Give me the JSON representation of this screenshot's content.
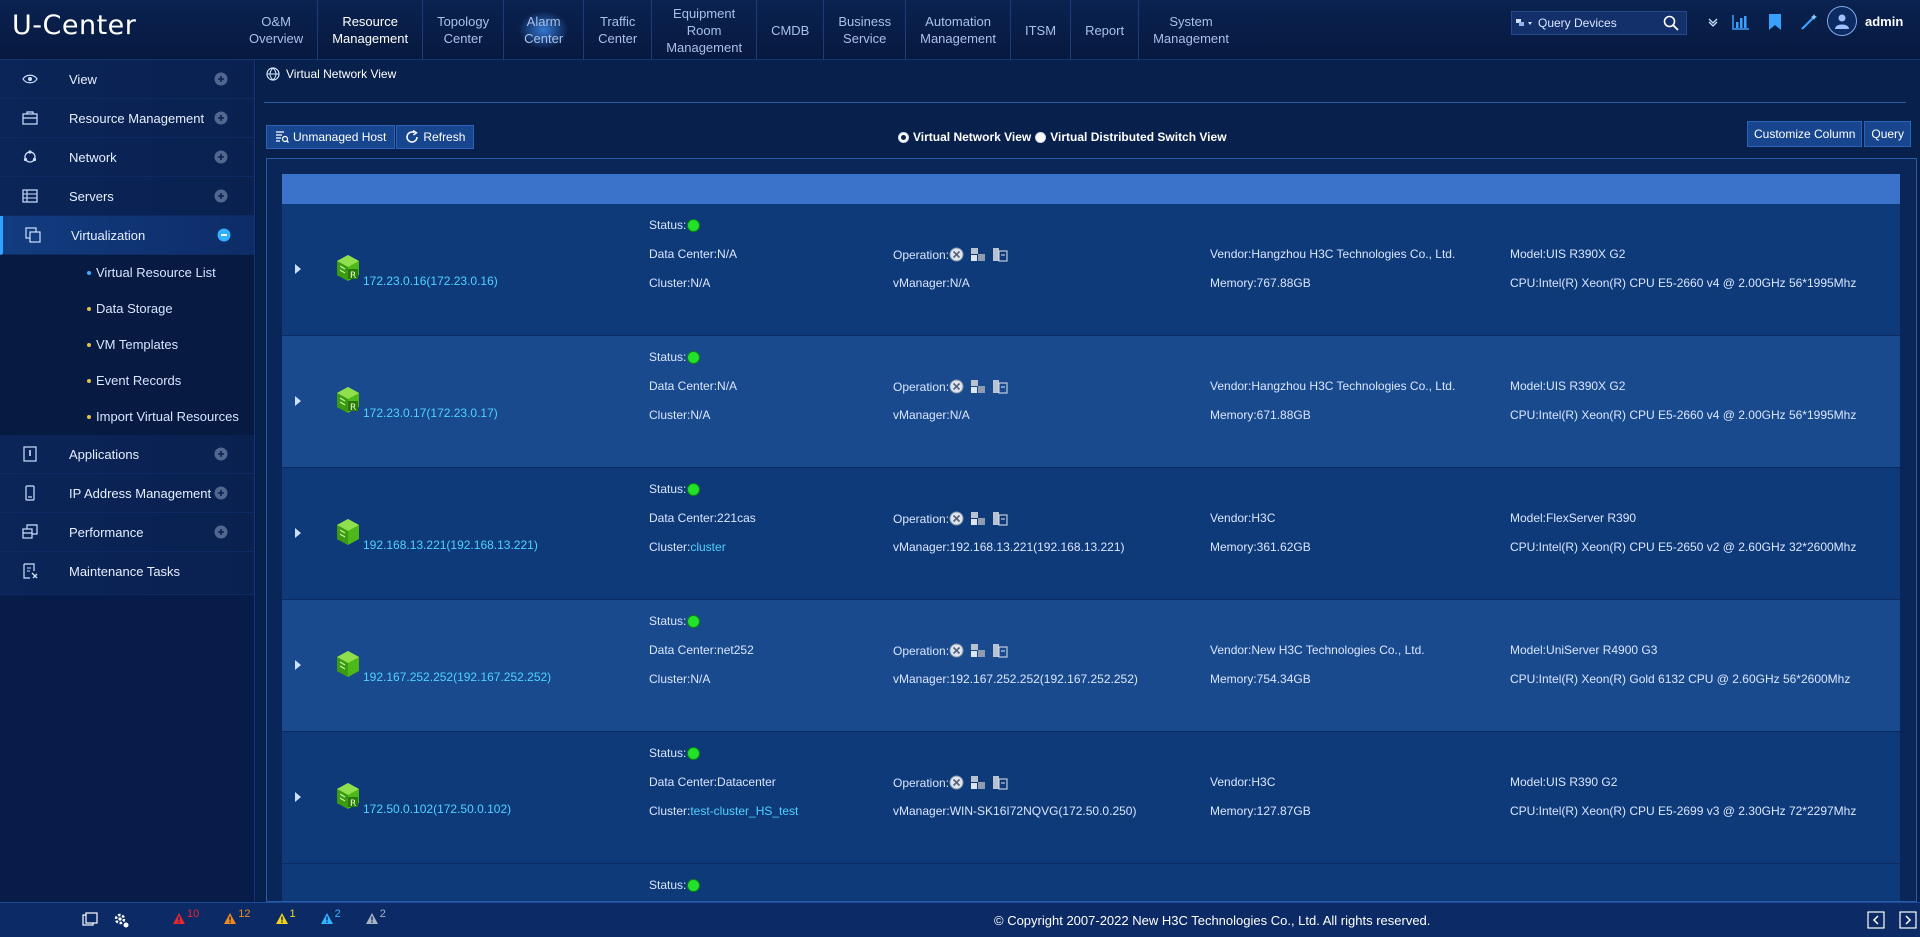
{
  "header": {
    "logo": "U-Center",
    "nav": [
      {
        "label": "O&M\nOverview"
      },
      {
        "label": "Resource\nManagement",
        "active": true
      },
      {
        "label": "Topology\nCenter"
      },
      {
        "label": "Alarm\nCenter",
        "glow": true
      },
      {
        "label": "Traffic\nCenter"
      },
      {
        "label": "Equipment\nRoom\nManagement"
      },
      {
        "label": "CMDB"
      },
      {
        "label": "Business\nService"
      },
      {
        "label": "Automation\nManagement"
      },
      {
        "label": "ITSM"
      },
      {
        "label": "Report"
      },
      {
        "label": "System\nManagement"
      }
    ],
    "search_placeholder": "Query Devices",
    "username": "admin"
  },
  "sidebar": {
    "items": [
      {
        "label": "View",
        "icon": "eye-icon"
      },
      {
        "label": "Resource Management",
        "icon": "briefcase-icon"
      },
      {
        "label": "Network",
        "icon": "network-icon"
      },
      {
        "label": "Servers",
        "icon": "server-icon"
      },
      {
        "label": "Virtualization",
        "icon": "virtualization-icon",
        "active": true
      }
    ],
    "sub_items": [
      {
        "label": "Virtual Resource List",
        "dot": "#4aa8ff"
      },
      {
        "label": "Data Storage",
        "dot": "#e3c04a"
      },
      {
        "label": "VM Templates",
        "dot": "#e3c04a"
      },
      {
        "label": "Event Records",
        "dot": "#e3c04a"
      },
      {
        "label": "Import Virtual Resources",
        "dot": "#e3c04a"
      }
    ],
    "items_after": [
      {
        "label": "Applications",
        "icon": "application-icon"
      },
      {
        "label": "IP Address Management",
        "icon": "ip-icon"
      },
      {
        "label": "Performance",
        "icon": "performance-icon"
      },
      {
        "label": "Maintenance Tasks",
        "icon": "maintenance-icon"
      }
    ]
  },
  "page": {
    "title": "Virtual Network View",
    "unmanaged_label": "Unmanaged Host",
    "refresh_label": "Refresh",
    "radio_vnv": "Virtual Network View",
    "radio_vds": "Virtual Distributed Switch View",
    "customize_label": "Customize Column",
    "query_label": "Query"
  },
  "labels": {
    "status": "Status:",
    "data_center": "Data Center:",
    "cluster": "Cluster:",
    "operation": "Operation:",
    "vmanager": "vManager:",
    "vendor": "Vendor:",
    "memory": "Memory:",
    "model": "Model:",
    "cpu": "CPU:"
  },
  "hosts": [
    {
      "name": "172.23.0.16(172.23.0.16)",
      "data_center": "N/A",
      "cluster": "N/A",
      "cluster_link": false,
      "vmanager": "N/A",
      "vendor": "Hangzhou H3C Technologies Co., Ltd.",
      "memory": "767.88GB",
      "model": "UIS R390X G2",
      "cpu": "Intel(R) Xeon(R) CPU E5-2660 v4 @ 2.00GHz 56*1995Mhz",
      "icon": "host-r-icon"
    },
    {
      "name": "172.23.0.17(172.23.0.17)",
      "data_center": "N/A",
      "cluster": "N/A",
      "cluster_link": false,
      "vmanager": "N/A",
      "vendor": "Hangzhou H3C Technologies Co., Ltd.",
      "memory": "671.88GB",
      "model": "UIS R390X G2",
      "cpu": "Intel(R) Xeon(R) CPU E5-2660 v4 @ 2.00GHz 56*1995Mhz",
      "icon": "host-r-icon"
    },
    {
      "name": "192.168.13.221(192.168.13.221)",
      "data_center": "221cas",
      "cluster": "cluster",
      "cluster_link": true,
      "vmanager": "192.168.13.221(192.168.13.221)",
      "vendor": "H3C",
      "memory": "361.62GB",
      "model": "FlexServer R390",
      "cpu": "Intel(R) Xeon(R) CPU E5-2650 v2 @ 2.60GHz 32*2600Mhz",
      "icon": "host-icon"
    },
    {
      "name": "192.167.252.252(192.167.252.252)",
      "data_center": "net252",
      "cluster": "N/A",
      "cluster_link": false,
      "vmanager": "192.167.252.252(192.167.252.252)",
      "vendor": "New H3C Technologies Co., Ltd.",
      "memory": "754.34GB",
      "model": "UniServer R4900 G3",
      "cpu": "Intel(R) Xeon(R) Gold 6132 CPU @ 2.60GHz 56*2600Mhz",
      "icon": "host-icon"
    },
    {
      "name": "172.50.0.102(172.50.0.102)",
      "data_center": "Datacenter",
      "cluster": "test-cluster_HS_test",
      "cluster_link": true,
      "vmanager": "WIN-SK16I72NQVG(172.50.0.250)",
      "vendor": "H3C",
      "memory": "127.87GB",
      "model": "UIS R390 G2",
      "cpu": "Intel(R) Xeon(R) CPU E5-2699 v3 @ 2.30GHz 72*2297Mhz",
      "icon": "host-r-icon"
    }
  ],
  "footer": {
    "alarms": [
      {
        "count": "10",
        "color": "#e8272b"
      },
      {
        "count": "12",
        "color": "#f08a1c"
      },
      {
        "count": "1",
        "color": "#f2d21a"
      },
      {
        "count": "2",
        "color": "#35b5ff"
      },
      {
        "count": "2",
        "color": "#a9b3c2"
      }
    ],
    "copyright": "© Copyright 2007-2022 New H3C Technologies Co., Ltd. All rights reserved."
  }
}
